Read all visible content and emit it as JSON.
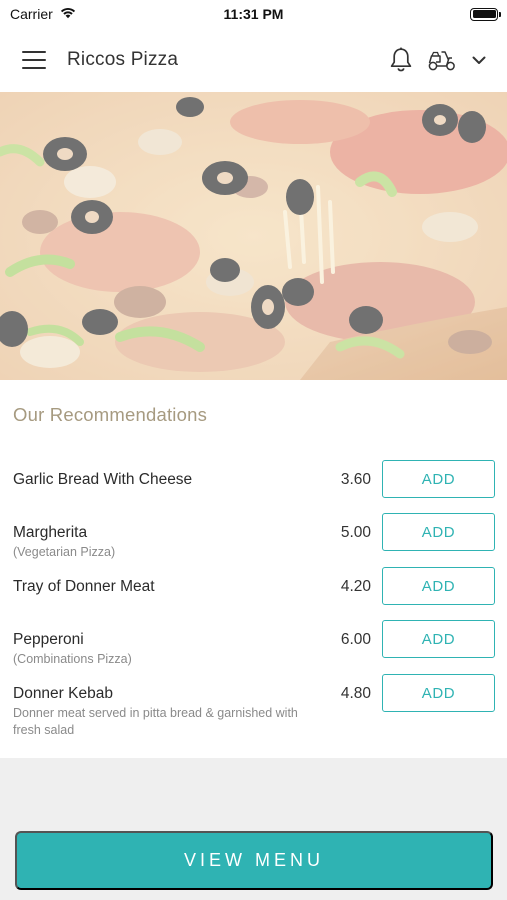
{
  "status_bar": {
    "carrier": "Carrier",
    "time": "11:31 PM",
    "icons": [
      "wifi-icon",
      "battery-icon"
    ]
  },
  "header": {
    "title": "Riccos Pizza",
    "icons": [
      "menu-icon",
      "bell-icon",
      "scooter-icon",
      "chevron-down-icon"
    ]
  },
  "hero": {
    "image": "pizza-photo"
  },
  "recommendations": {
    "title": "Our Recommendations",
    "items": [
      {
        "name": "Garlic Bread With Cheese",
        "desc": "",
        "price": "3.60",
        "button": "ADD"
      },
      {
        "name": "Margherita",
        "desc": "(Vegetarian Pizza)",
        "price": "5.00",
        "button": "ADD"
      },
      {
        "name": "Tray of Donner Meat",
        "desc": "",
        "price": "4.20",
        "button": "ADD"
      },
      {
        "name": "Pepperoni",
        "desc": "(Combinations Pizza)",
        "price": "6.00",
        "button": "ADD"
      },
      {
        "name": "Donner Kebab",
        "desc": "Donner meat served in pitta bread & garnished with fresh salad",
        "price": "4.80",
        "button": "ADD"
      }
    ]
  },
  "footer": {
    "view_menu_label": "VIEW MENU"
  },
  "colors": {
    "accent": "#2fb3b3",
    "section_title": "#a69a80",
    "band": "#efefef"
  }
}
